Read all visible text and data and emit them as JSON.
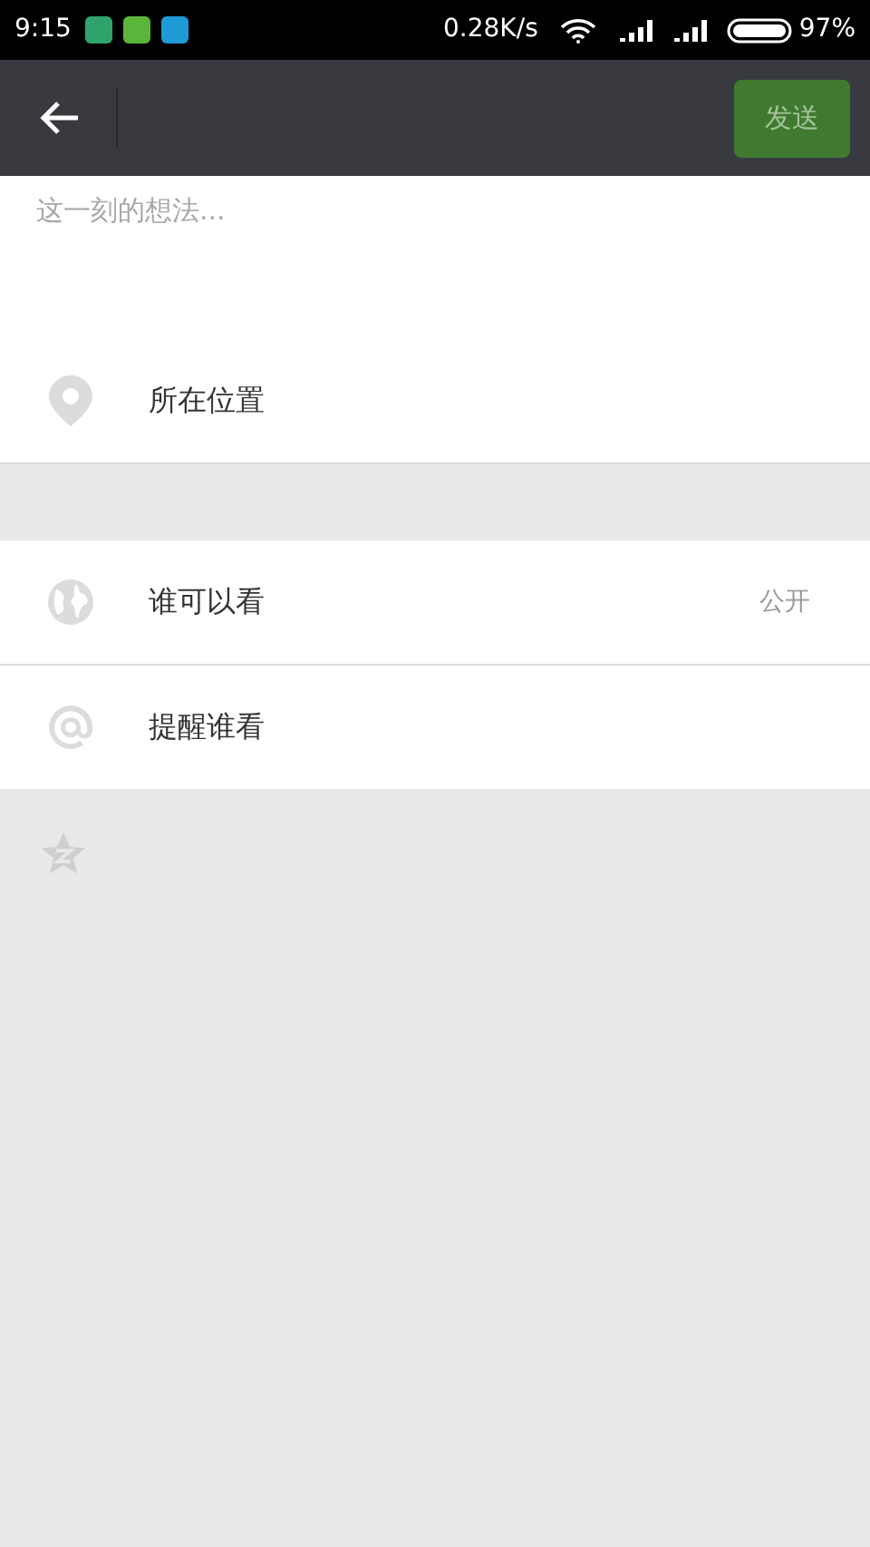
{
  "status_bar": {
    "time": "9:15",
    "speed": "0.28K/s",
    "battery": "97%",
    "app_icons": [
      {
        "color": "#2fa36b"
      },
      {
        "color": "#5bb53a"
      },
      {
        "color": "#1e9ad6"
      }
    ]
  },
  "toolbar": {
    "send_button": "发送"
  },
  "post": {
    "placeholder": "这一刻的想法..."
  },
  "location": {
    "label": "所在位置"
  },
  "options": [
    {
      "kind": "visibility",
      "label": "谁可以看",
      "value": "公开"
    },
    {
      "kind": "mention",
      "label": "提醒谁看"
    }
  ],
  "extra": {
    "kind": "qzone"
  }
}
